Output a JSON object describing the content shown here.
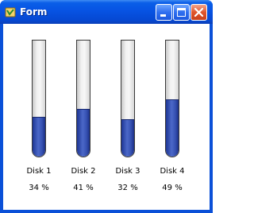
{
  "window": {
    "title": "Form",
    "icon": "app-icon",
    "buttons": {
      "minimize": "minimize-icon",
      "maximize": "maximize-icon",
      "close": "close-icon"
    },
    "colors": {
      "titlebar": "#0753e3",
      "fill": "#3651b2",
      "tube": "#f2f2f2"
    }
  },
  "disks": [
    {
      "label": "Disk 1",
      "percent_text": "34 %",
      "level": 0.34
    },
    {
      "label": "Disk 2",
      "percent_text": "41 %",
      "level": 0.41
    },
    {
      "label": "Disk 3",
      "percent_text": "32 %",
      "level": 0.32
    },
    {
      "label": "Disk 4",
      "percent_text": "49 %",
      "level": 0.49
    }
  ]
}
